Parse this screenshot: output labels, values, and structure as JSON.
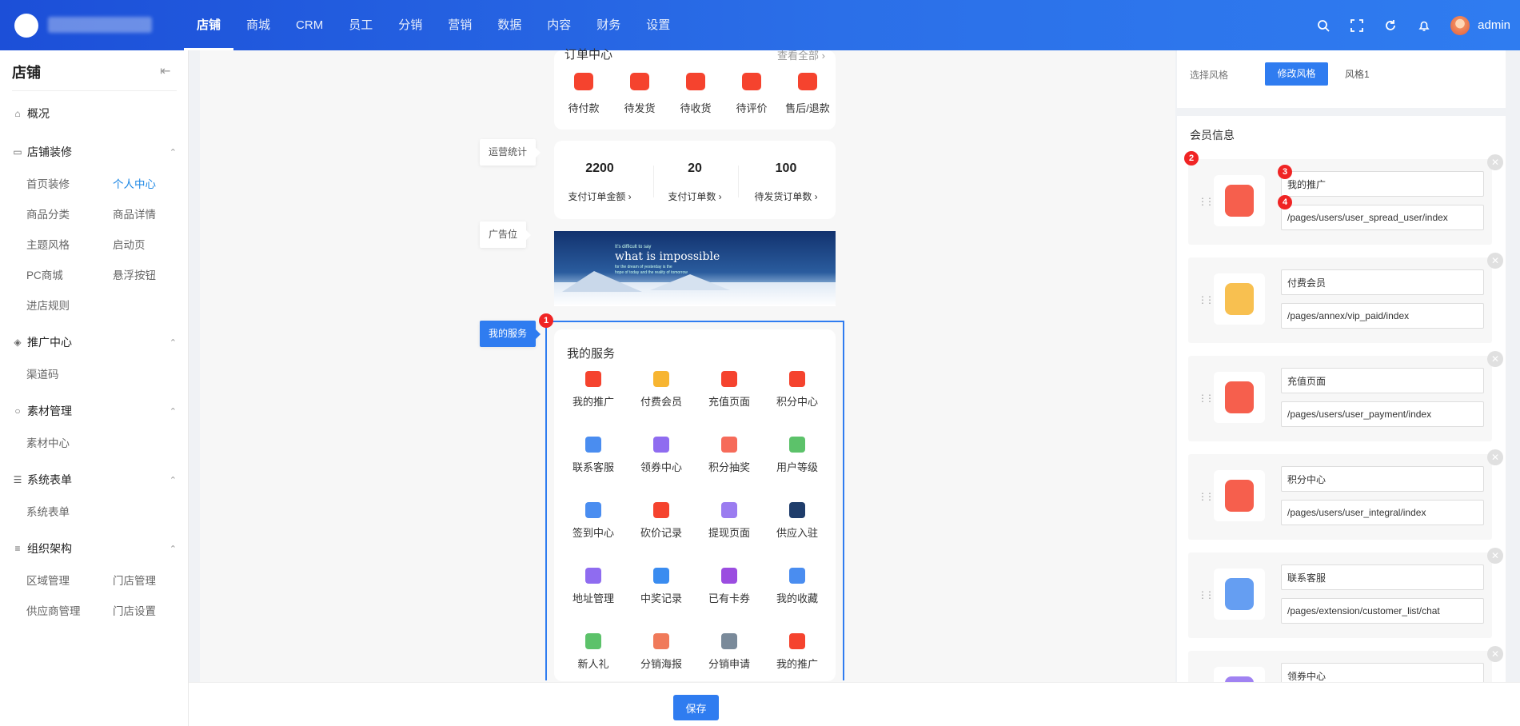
{
  "topbar": {
    "brand_text": "",
    "nav": [
      "店铺",
      "商城",
      "CRM",
      "员工",
      "分销",
      "营销",
      "数据",
      "内容",
      "财务",
      "设置"
    ],
    "user": "admin"
  },
  "sidebar": {
    "title": "店铺",
    "groups": [
      {
        "label": "概况"
      },
      {
        "label": "店铺装修",
        "items": [
          "首页装修",
          "个人中心",
          "商品分类",
          "商品详情",
          "主题风格",
          "启动页",
          "PC商城",
          "悬浮按钮",
          "进店规则"
        ]
      },
      {
        "label": "推广中心",
        "items": [
          "渠道码"
        ]
      },
      {
        "label": "素材管理",
        "items": [
          "素材中心"
        ]
      },
      {
        "label": "系统表单",
        "items": [
          "系统表单"
        ]
      },
      {
        "label": "组织架构",
        "items": [
          "区域管理",
          "门店管理",
          "供应商管理",
          "门店设置"
        ]
      }
    ],
    "active_item": "个人中心"
  },
  "preview": {
    "order": {
      "title": "订单中心",
      "view_all": "查看全部",
      "items": [
        "待付款",
        "待发货",
        "待收货",
        "待评价",
        "售后/退款"
      ]
    },
    "tags": {
      "stats": "运营统计",
      "ad": "广告位",
      "service": "我的服务"
    },
    "stats": [
      {
        "value": "2200",
        "label": "支付订单金额"
      },
      {
        "value": "20",
        "label": "支付订单数"
      },
      {
        "value": "100",
        "label": "待发货订单数"
      }
    ],
    "banner": {
      "line1": "It's difficult to say",
      "line2": "what is impossible",
      "line3": "for the dream of yesterday is the",
      "line4": "hope of today and the reality of tomorrow"
    },
    "services": {
      "title": "我的服务",
      "items": [
        {
          "label": "我的推广",
          "color": "#f5432e"
        },
        {
          "label": "付费会员",
          "color": "#f7b531"
        },
        {
          "label": "充值页面",
          "color": "#f5432e"
        },
        {
          "label": "积分中心",
          "color": "#f5432e"
        },
        {
          "label": "联系客服",
          "color": "#4a8df0"
        },
        {
          "label": "领券中心",
          "color": "#8f6cf0"
        },
        {
          "label": "积分抽奖",
          "color": "#f66b5a"
        },
        {
          "label": "用户等级",
          "color": "#5cc26a"
        },
        {
          "label": "签到中心",
          "color": "#4a8df0"
        },
        {
          "label": "砍价记录",
          "color": "#f5432e"
        },
        {
          "label": "提现页面",
          "color": "#9b7cf0"
        },
        {
          "label": "供应入驻",
          "color": "#1f3d6b"
        },
        {
          "label": "地址管理",
          "color": "#8f6cf0"
        },
        {
          "label": "中奖记录",
          "color": "#3a8cf0"
        },
        {
          "label": "已有卡券",
          "color": "#9b4de0"
        },
        {
          "label": "我的收藏",
          "color": "#4a8df0"
        },
        {
          "label": "新人礼",
          "color": "#5cc26a"
        },
        {
          "label": "分销海报",
          "color": "#f07a5a"
        },
        {
          "label": "分销申请",
          "color": "#7a8a9a"
        },
        {
          "label": "我的推广",
          "color": "#f5432e"
        }
      ]
    },
    "badges": [
      "1",
      "2",
      "3",
      "4"
    ]
  },
  "bottom": {
    "save": "保存"
  },
  "settings": {
    "style_label": "选择风格",
    "style_button": "修改风格",
    "style_value": "风格1",
    "member_title": "会员信息",
    "items": [
      {
        "name": "我的推广",
        "url": "/pages/users/user_spread_user/index",
        "color": "#f5432e"
      },
      {
        "name": "付费会员",
        "url": "/pages/annex/vip_paid/index",
        "color": "#f7b531"
      },
      {
        "name": "充值页面",
        "url": "/pages/users/user_payment/index",
        "color": "#f5432e"
      },
      {
        "name": "积分中心",
        "url": "/pages/users/user_integral/index",
        "color": "#f5432e"
      },
      {
        "name": "联系客服",
        "url": "/pages/extension/customer_list/chat",
        "color": "#4a8df0"
      },
      {
        "name": "领券中心",
        "url": "",
        "color": "#8f6cf0"
      }
    ]
  }
}
